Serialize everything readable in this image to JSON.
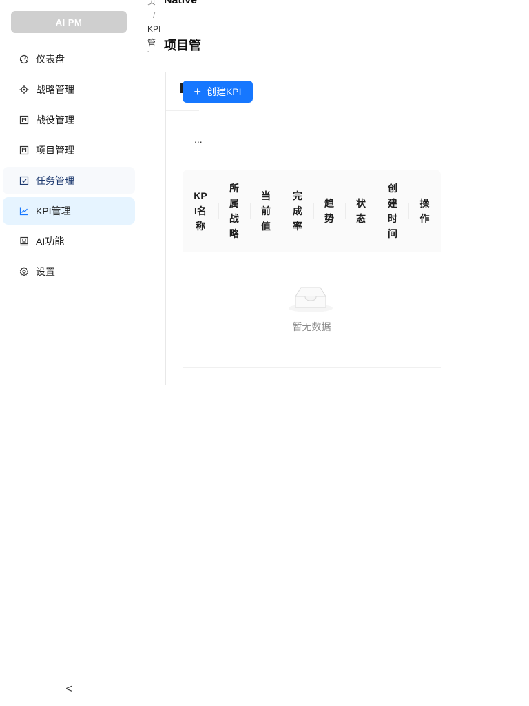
{
  "app": {
    "logo": "AI PM"
  },
  "sidebar": {
    "items": [
      {
        "label": "仪表盘",
        "icon": "dashboard-icon"
      },
      {
        "label": "战略管理",
        "icon": "aim-icon"
      },
      {
        "label": "战役管理",
        "icon": "project-board-icon"
      },
      {
        "label": "项目管理",
        "icon": "project-board-icon"
      },
      {
        "label": "任务管理",
        "icon": "checkbox-icon"
      },
      {
        "label": "KPI管理",
        "icon": "line-chart-icon"
      },
      {
        "label": "AI功能",
        "icon": "robot-icon"
      },
      {
        "label": "设置",
        "icon": "gear-icon"
      }
    ],
    "active_index": 5,
    "hover_index": 4,
    "collapse_glyph": "<"
  },
  "header": {
    "breadcrumb": [
      "页",
      "/",
      "KPI",
      "管",
      "-"
    ],
    "title_top": "Native",
    "title": "项目管"
  },
  "toolbar": {
    "create_label": "创建KPI",
    "more_label": "..."
  },
  "table": {
    "columns": [
      "KPI名称",
      "所属战略",
      "当前值",
      "完成率",
      "趋势",
      "状态",
      "创建时间",
      "操作"
    ],
    "empty_text": "暂无数据"
  },
  "colors": {
    "primary": "#1677ff",
    "active_bg": "#e6f4ff",
    "header_bg": "#fafafa"
  }
}
